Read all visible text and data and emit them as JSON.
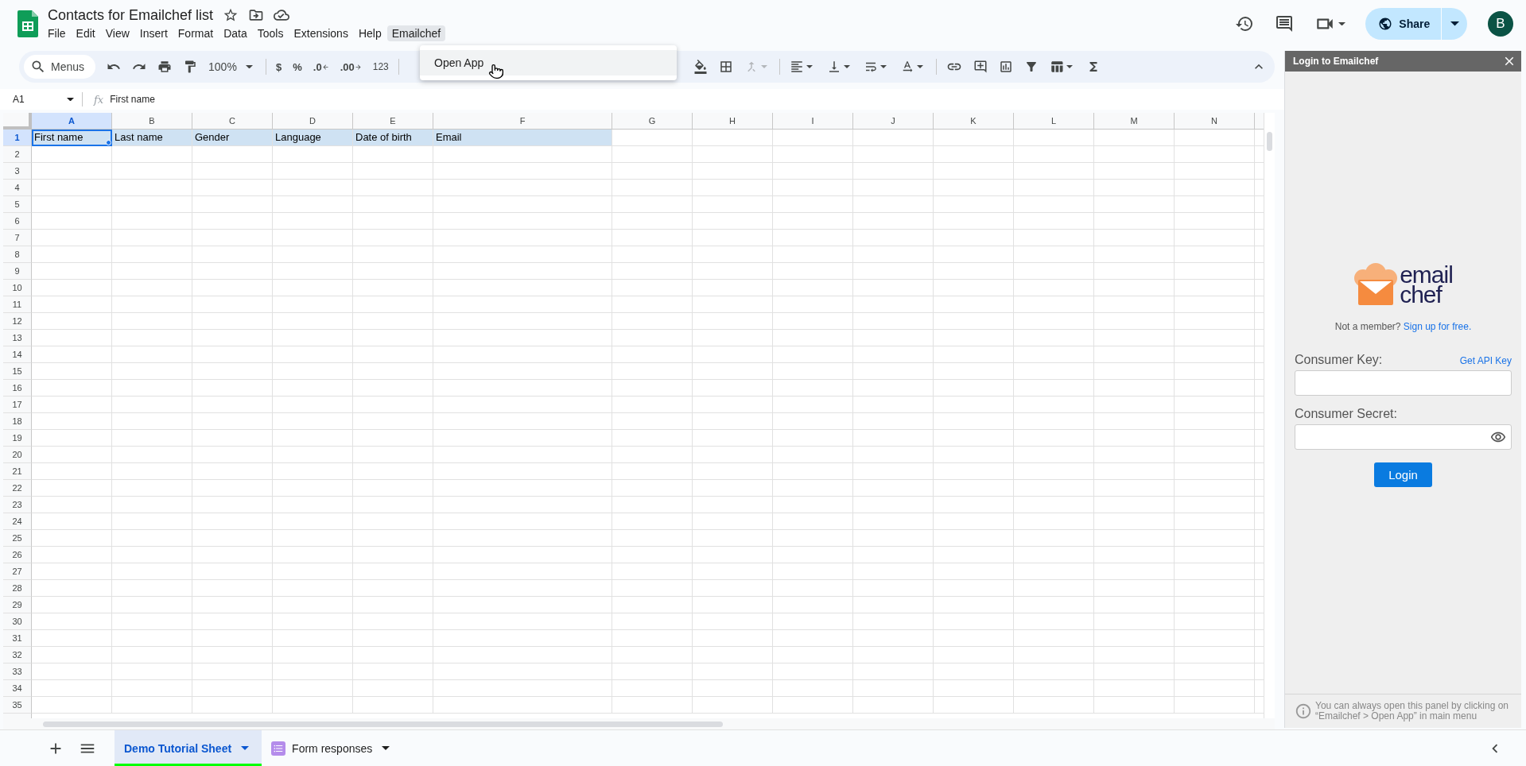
{
  "document": {
    "title": "Contacts for Emailchef list"
  },
  "menu_bar": [
    {
      "label": "File",
      "open": false
    },
    {
      "label": "Edit",
      "open": false
    },
    {
      "label": "View",
      "open": false
    },
    {
      "label": "Insert",
      "open": false
    },
    {
      "label": "Format",
      "open": false
    },
    {
      "label": "Data",
      "open": false
    },
    {
      "label": "Tools",
      "open": false
    },
    {
      "label": "Extensions",
      "open": false
    },
    {
      "label": "Help",
      "open": false
    },
    {
      "label": "Emailchef",
      "open": true
    }
  ],
  "open_menu": {
    "items": [
      {
        "label": "Open App",
        "highlighted": true
      }
    ]
  },
  "header_actions": {
    "share": "Share",
    "avatar": "B"
  },
  "toolbar": {
    "search_placeholder": "Menus",
    "zoom": "100%",
    "format_buttons": [
      "$",
      "%",
      ".0",
      ".00",
      "123"
    ]
  },
  "formula_bar": {
    "cell_reference": "A1",
    "function_label": "fx",
    "formula": "First name"
  },
  "sheet": {
    "columns": [
      {
        "label": "A",
        "selected": true
      },
      {
        "label": "B",
        "selected": false
      },
      {
        "label": "C",
        "selected": false
      },
      {
        "label": "D",
        "selected": false
      },
      {
        "label": "E",
        "selected": false
      },
      {
        "label": "F",
        "selected": false
      },
      {
        "label": "G",
        "selected": false
      },
      {
        "label": "H",
        "selected": false
      },
      {
        "label": "I",
        "selected": false
      },
      {
        "label": "J",
        "selected": false
      },
      {
        "label": "K",
        "selected": false
      },
      {
        "label": "L",
        "selected": false
      },
      {
        "label": "M",
        "selected": false
      },
      {
        "label": "N",
        "selected": false
      }
    ],
    "rows": [
      {
        "label": "1",
        "selected": true,
        "cells": [
          {
            "text": "First name",
            "selected": true
          },
          {
            "text": "Last name",
            "selected": false
          },
          {
            "text": "Gender",
            "selected": false
          },
          {
            "text": "Language",
            "selected": false
          },
          {
            "text": "Date of birth",
            "selected": false
          },
          {
            "text": "Email",
            "selected": false
          }
        ]
      },
      {
        "label": "2",
        "selected": false
      },
      {
        "label": "3",
        "selected": false
      },
      {
        "label": "4",
        "selected": false
      },
      {
        "label": "5",
        "selected": false
      },
      {
        "label": "6",
        "selected": false
      },
      {
        "label": "7",
        "selected": false
      },
      {
        "label": "8",
        "selected": false
      },
      {
        "label": "9",
        "selected": false
      },
      {
        "label": "10",
        "selected": false
      },
      {
        "label": "11",
        "selected": false
      },
      {
        "label": "12",
        "selected": false
      },
      {
        "label": "13",
        "selected": false
      },
      {
        "label": "14",
        "selected": false
      },
      {
        "label": "15",
        "selected": false
      },
      {
        "label": "16",
        "selected": false
      },
      {
        "label": "17",
        "selected": false
      },
      {
        "label": "18",
        "selected": false
      },
      {
        "label": "19",
        "selected": false
      },
      {
        "label": "20",
        "selected": false
      },
      {
        "label": "21",
        "selected": false
      },
      {
        "label": "22",
        "selected": false
      },
      {
        "label": "23",
        "selected": false
      },
      {
        "label": "24",
        "selected": false
      },
      {
        "label": "25",
        "selected": false
      },
      {
        "label": "26",
        "selected": false
      },
      {
        "label": "27",
        "selected": false
      },
      {
        "label": "28",
        "selected": false
      },
      {
        "label": "29",
        "selected": false
      },
      {
        "label": "30",
        "selected": false
      },
      {
        "label": "31",
        "selected": false
      },
      {
        "label": "32",
        "selected": false
      },
      {
        "label": "33",
        "selected": false
      },
      {
        "label": "34",
        "selected": false
      },
      {
        "label": "35",
        "selected": false
      }
    ]
  },
  "sheet_tabs": [
    {
      "label": "Demo Tutorial Sheet",
      "selected": true,
      "kind": "sheet",
      "color": "#00ff00"
    },
    {
      "label": "Form responses",
      "selected": false,
      "kind": "form"
    }
  ],
  "side_panel": {
    "title": "Login to Emailchef",
    "logo": [
      "email",
      "chef"
    ],
    "signup_prompt": "Not a member?",
    "signup_link": "Sign up for free.",
    "fields": [
      {
        "label": "Consumer Key:",
        "link": "Get API Key",
        "kind": "text"
      },
      {
        "label": "Consumer Secret:",
        "kind": "password"
      }
    ],
    "login_button": "Login",
    "footer_note": "You can always open this panel by clicking on “Emailchef > Open App” in main menu"
  }
}
